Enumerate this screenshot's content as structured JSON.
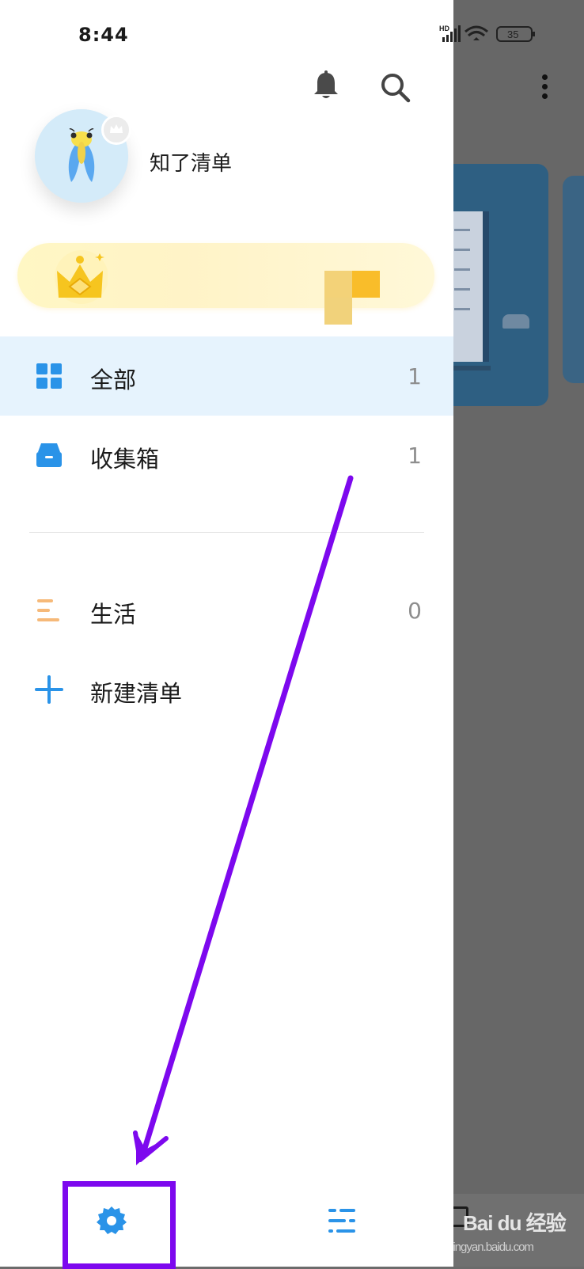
{
  "status_bar": {
    "time": "8:44",
    "network_label": "HD",
    "battery_level": "35"
  },
  "header": {
    "bell_icon": "bell-icon",
    "search_icon": "search-icon"
  },
  "profile": {
    "name": "知了清单",
    "avatar_icon": "cicada-avatar",
    "badge_icon": "crown-badge-icon"
  },
  "vip_banner": {
    "icon": "gold-crown-icon"
  },
  "nav": {
    "all": {
      "label": "全部",
      "count": "1",
      "icon": "grid-icon"
    },
    "inbox": {
      "label": "收集箱",
      "count": "1",
      "icon": "inbox-icon"
    },
    "life": {
      "label": "生活",
      "count": "0",
      "icon": "list-icon"
    },
    "new_list": {
      "label": "新建清单",
      "icon": "plus-icon"
    }
  },
  "bottom_bar": {
    "settings_icon": "gear-icon",
    "manage_icon": "sliders-icon"
  },
  "annotation": {
    "color": "#7d08ee"
  },
  "watermark": {
    "text": "Bai du 经验",
    "sub": "jingyan.baidu.com"
  },
  "colors": {
    "accent_blue": "#2a93e8",
    "active_row_bg": "#e6f3fd",
    "vip_gold": "#fde07a",
    "life_icon_orange": "#f6b979"
  }
}
